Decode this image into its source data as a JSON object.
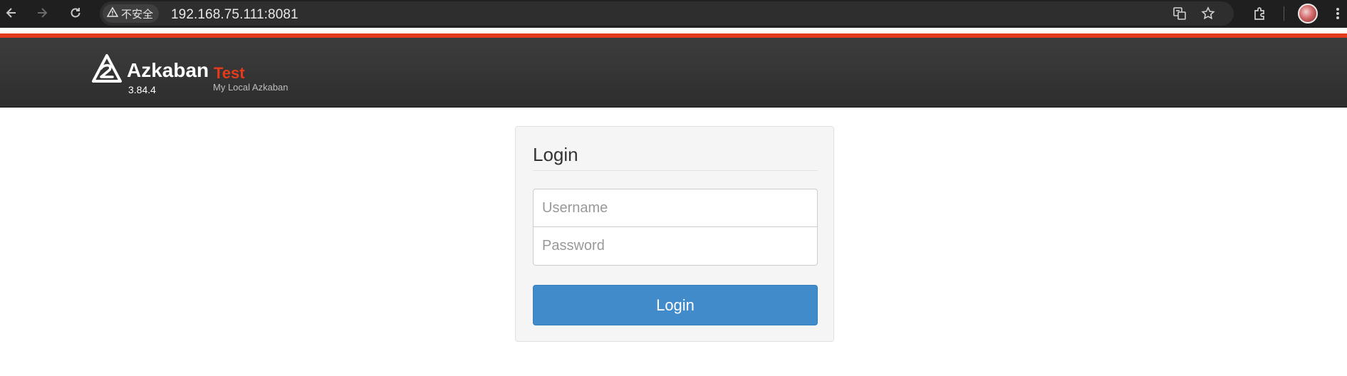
{
  "browser": {
    "security_label": "不安全",
    "url": "192.168.75.111:8081"
  },
  "header": {
    "brand": "Azkaban",
    "version": "3.84.4",
    "env_name": "Test",
    "env_description": "My Local Azkaban",
    "accent_color": "#e33b1c"
  },
  "login": {
    "title": "Login",
    "username_placeholder": "Username",
    "password_placeholder": "Password",
    "submit_label": "Login",
    "button_color": "#428bca"
  }
}
